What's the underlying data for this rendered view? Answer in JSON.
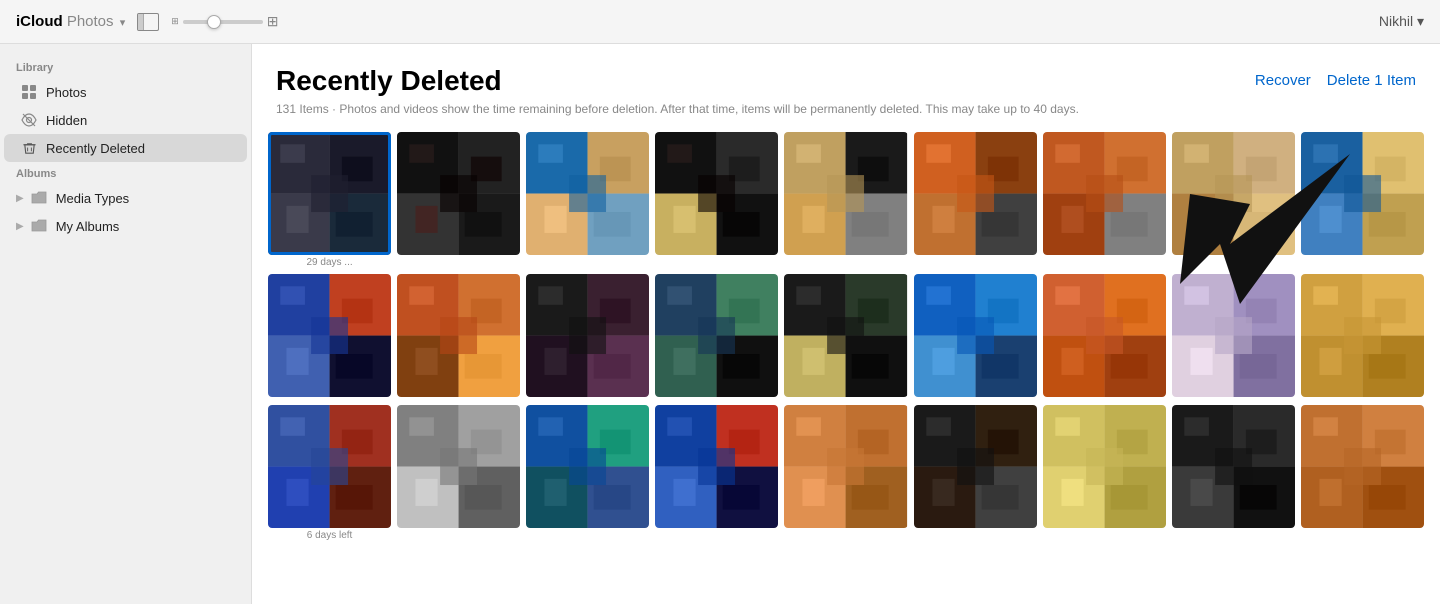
{
  "topbar": {
    "app_name": "iCloud",
    "app_subtitle": "Photos",
    "chevron": "▾",
    "user_name": "Nikhil",
    "user_chevron": "▾"
  },
  "sidebar": {
    "library_label": "Library",
    "library_items": [
      {
        "id": "photos",
        "label": "Photos",
        "icon": "grid"
      },
      {
        "id": "hidden",
        "label": "Hidden",
        "icon": "eye-slash"
      },
      {
        "id": "recently-deleted",
        "label": "Recently Deleted",
        "icon": "trash",
        "active": true
      }
    ],
    "albums_label": "Albums",
    "albums_groups": [
      {
        "id": "media-types",
        "label": "Media Types",
        "icon": "folder"
      },
      {
        "id": "my-albums",
        "label": "My Albums",
        "icon": "folder"
      }
    ]
  },
  "main": {
    "title": "Recently Deleted",
    "item_count": "131 Items",
    "subtitle": "Photos and videos show the time remaining before deletion. After that time, items will be permanently deleted. This may take up to 40 days.",
    "recover_label": "Recover",
    "delete_label": "Delete 1 Item"
  },
  "photos": {
    "rows": [
      {
        "cells": [
          {
            "id": "p1",
            "selected": true,
            "label_below": "29 days ...",
            "colors": [
              "#2a2a3a",
              "#1a1a2a",
              "#3a3a4a",
              "#1a2a3a"
            ]
          },
          {
            "id": "p2",
            "selected": false,
            "label_below": "",
            "colors": [
              "#111",
              "#222",
              "#333",
              "#1a1a1a"
            ]
          },
          {
            "id": "p3",
            "selected": false,
            "label_below": "",
            "colors": [
              "#1a6aaa",
              "#c8a060",
              "#e0b070",
              "#70a0c0"
            ]
          },
          {
            "id": "p4",
            "selected": false,
            "label_below": "",
            "colors": [
              "#111",
              "#2a2a2a",
              "#c8b060",
              "#111"
            ]
          },
          {
            "id": "p5",
            "selected": false,
            "label_below": "",
            "colors": [
              "#c0a060",
              "#1a1a1a",
              "#d0a050",
              "#808080"
            ]
          },
          {
            "id": "p6",
            "selected": false,
            "label_below": "",
            "colors": [
              "#d06020",
              "#8a4010",
              "#c07030",
              "#404040"
            ]
          },
          {
            "id": "p7",
            "selected": false,
            "label_below": "",
            "colors": [
              "#c05820",
              "#d07030",
              "#a04010",
              "#808080"
            ]
          },
          {
            "id": "p8",
            "selected": false,
            "label_below": "",
            "colors": [
              "#c0a060",
              "#d0b080",
              "#b08040",
              "#e0c080"
            ]
          },
          {
            "id": "p9",
            "selected": false,
            "label_below": "",
            "colors": [
              "#1a60a0",
              "#e0c070",
              "#4080c0",
              "#c0a050"
            ]
          }
        ]
      },
      {
        "cells": [
          {
            "id": "p10",
            "selected": false,
            "label_below": "",
            "colors": [
              "#2040a0",
              "#c04020",
              "#4060b0",
              "#101030"
            ]
          },
          {
            "id": "p11",
            "selected": false,
            "label_below": "",
            "colors": [
              "#c05020",
              "#d07030",
              "#804010",
              "#f0a040"
            ]
          },
          {
            "id": "p12",
            "selected": false,
            "label_below": "",
            "colors": [
              "#1a1a1a",
              "#3a2030",
              "#201020",
              "#5a3050"
            ]
          },
          {
            "id": "p13",
            "selected": false,
            "label_below": "",
            "colors": [
              "#204060",
              "#408060",
              "#306050",
              "#101010"
            ]
          },
          {
            "id": "p14",
            "selected": false,
            "label_below": "",
            "colors": [
              "#1a1a1a",
              "#2a3a2a",
              "#c0b060",
              "#101010"
            ]
          },
          {
            "id": "p15",
            "selected": false,
            "label_below": "",
            "colors": [
              "#1060c0",
              "#2080d0",
              "#4090d0",
              "#1a4070"
            ]
          },
          {
            "id": "p16",
            "selected": false,
            "label_below": "",
            "colors": [
              "#d06030",
              "#e07020",
              "#c05010",
              "#a04010"
            ]
          },
          {
            "id": "p17",
            "selected": false,
            "label_below": "",
            "colors": [
              "#c0b0d0",
              "#a090c0",
              "#e0d0e0",
              "#8070a0"
            ]
          },
          {
            "id": "p18",
            "selected": false,
            "label_below": "",
            "colors": [
              "#d0a040",
              "#e0b050",
              "#c09030",
              "#b08020"
            ]
          }
        ]
      },
      {
        "cells": [
          {
            "id": "p19",
            "selected": false,
            "label_below": "6 days left",
            "colors": [
              "#3050a0",
              "#a03020",
              "#2040b0",
              "#602010"
            ]
          },
          {
            "id": "p20",
            "selected": false,
            "label_below": "",
            "colors": [
              "#808080",
              "#a0a0a0",
              "#c0c0c0",
              "#606060"
            ]
          },
          {
            "id": "p21",
            "selected": false,
            "label_below": "",
            "colors": [
              "#1050a0",
              "#20a080",
              "#105060",
              "#305090"
            ]
          },
          {
            "id": "p22",
            "selected": false,
            "label_below": "",
            "colors": [
              "#1040a0",
              "#c03020",
              "#3060c0",
              "#101040"
            ]
          },
          {
            "id": "p23",
            "selected": false,
            "label_below": "",
            "colors": [
              "#d08040",
              "#c07030",
              "#e09050",
              "#a06020"
            ]
          },
          {
            "id": "p24",
            "selected": false,
            "label_below": "",
            "colors": [
              "#1a1a1a",
              "#302010",
              "#2a1a10",
              "#404040"
            ]
          },
          {
            "id": "p25",
            "selected": false,
            "label_below": "",
            "colors": [
              "#d0c060",
              "#c0b050",
              "#e0d070",
              "#b0a040"
            ]
          },
          {
            "id": "p26",
            "selected": false,
            "label_below": "",
            "colors": [
              "#1a1a1a",
              "#2a2a2a",
              "#3a3a3a",
              "#111"
            ]
          },
          {
            "id": "p27",
            "selected": false,
            "label_below": "",
            "colors": [
              "#c07030",
              "#d08040",
              "#b06020",
              "#a05010"
            ]
          }
        ]
      }
    ]
  }
}
